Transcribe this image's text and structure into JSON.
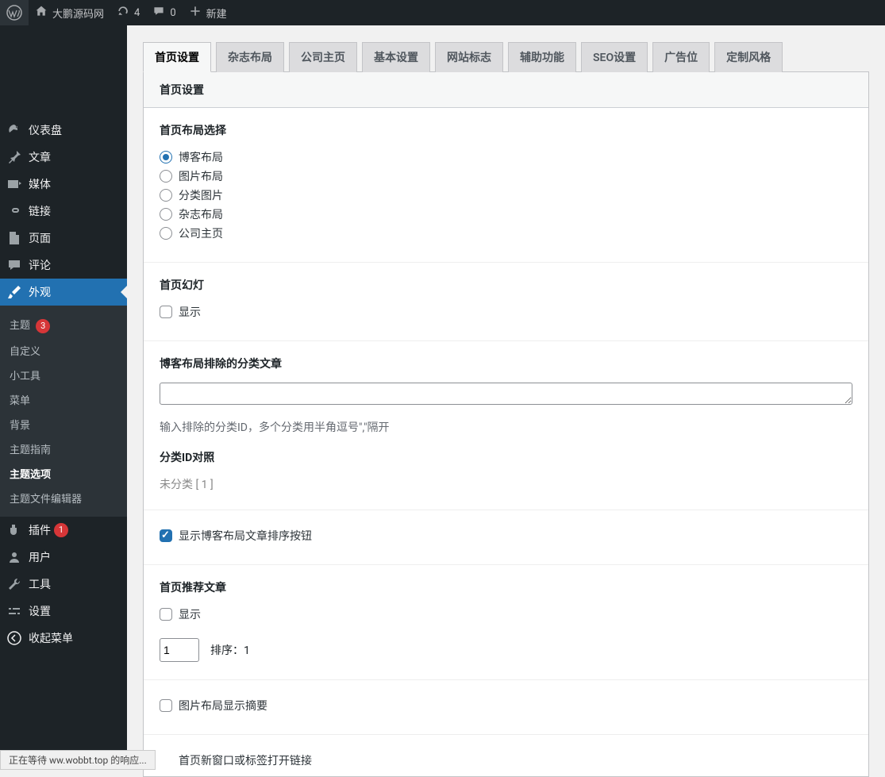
{
  "adminbar": {
    "site_title": "大鹏源码网",
    "updates": "4",
    "comments": "0",
    "new_label": "新建"
  },
  "sidebar": {
    "items": [
      {
        "label": "仪表盘"
      },
      {
        "label": "文章"
      },
      {
        "label": "媒体"
      },
      {
        "label": "链接"
      },
      {
        "label": "页面"
      },
      {
        "label": "评论"
      },
      {
        "label": "外观"
      },
      {
        "label": "插件",
        "count": "1"
      },
      {
        "label": "用户"
      },
      {
        "label": "工具"
      },
      {
        "label": "设置"
      },
      {
        "label": "收起菜单"
      }
    ],
    "submenu": [
      {
        "label": "主题",
        "count": "3"
      },
      {
        "label": "自定义"
      },
      {
        "label": "小工具"
      },
      {
        "label": "菜单"
      },
      {
        "label": "背景"
      },
      {
        "label": "主题指南"
      },
      {
        "label": "主题选项"
      },
      {
        "label": "主题文件编辑器"
      }
    ]
  },
  "tabs": [
    "首页设置",
    "杂志布局",
    "公司主页",
    "基本设置",
    "网站标志",
    "辅助功能",
    "SEO设置",
    "广告位",
    "定制风格"
  ],
  "panel": {
    "title": "首页设置",
    "layout": {
      "title": "首页布局选择",
      "options": [
        "博客布局",
        "图片布局",
        "分类图片",
        "杂志布局",
        "公司主页"
      ]
    },
    "slideshow": {
      "title": "首页幻灯",
      "label": "显示"
    },
    "exclude": {
      "title": "博客布局排除的分类文章",
      "help": "输入排除的分类ID，多个分类用半角逗号\",\"隔开",
      "id_title": "分类ID对照",
      "id_text": "未分类 [ 1 ]"
    },
    "sort_btn": {
      "label": "显示博客布局文章排序按钮"
    },
    "featured": {
      "title": "首页推荐文章",
      "label": "显示",
      "order_value": "1",
      "order_label": "排序：",
      "order_num": "1"
    },
    "pic_summary": {
      "label": "图片布局显示摘要"
    },
    "new_window": {
      "label": "首页新窗口或标签打开链接"
    }
  },
  "statusbar": "正在等待 ww.wobbt.top 的响应..."
}
